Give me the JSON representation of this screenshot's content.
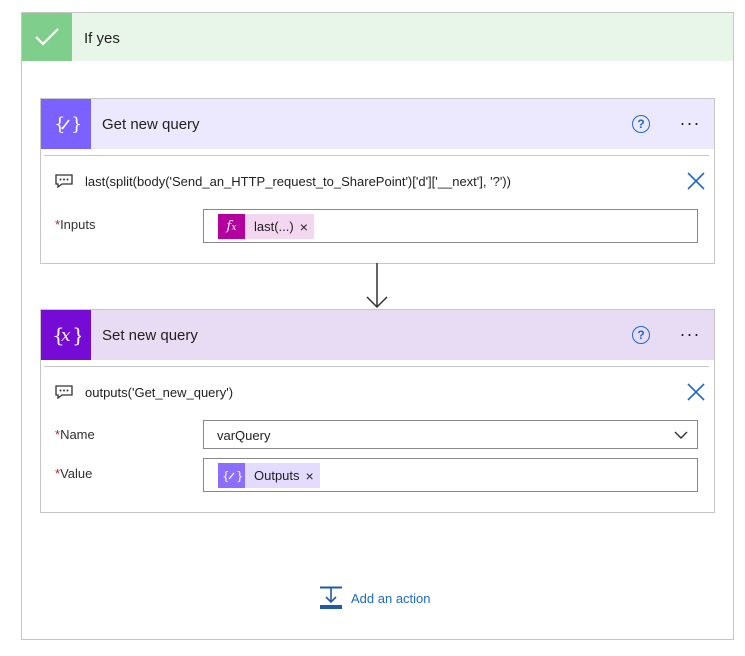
{
  "branch": {
    "title": "If yes",
    "accent_color": "#7fce8b",
    "header_bg": "#e7f6e9"
  },
  "actions": [
    {
      "title": "Get new query",
      "icon": "variable-edit-icon",
      "color": "#7b61ff",
      "expression": "last(split(body('Send_an_HTTP_request_to_SharePoint')['d']['__next'], '?'))",
      "fields": [
        {
          "label": "Inputs",
          "required_mark": "*",
          "token": {
            "icon": "fx-function-icon",
            "label": "last(...)",
            "color": "#b4009e"
          }
        }
      ]
    },
    {
      "title": "Set new query",
      "icon": "variable-x-icon",
      "color": "#770bd6",
      "expression": "outputs('Get_new_query')",
      "fields": [
        {
          "label": "Name",
          "required_mark": "*",
          "select_value": "varQuery"
        },
        {
          "label": "Value",
          "required_mark": "*",
          "token": {
            "icon": "variable-edit-icon",
            "label": "Outputs",
            "color": "#8b6dff"
          }
        }
      ]
    }
  ],
  "footer": {
    "add_action_label": "Add an action",
    "link_color": "#1f69c9"
  },
  "icons": {
    "help": "?",
    "more": "···",
    "remove": "×"
  }
}
